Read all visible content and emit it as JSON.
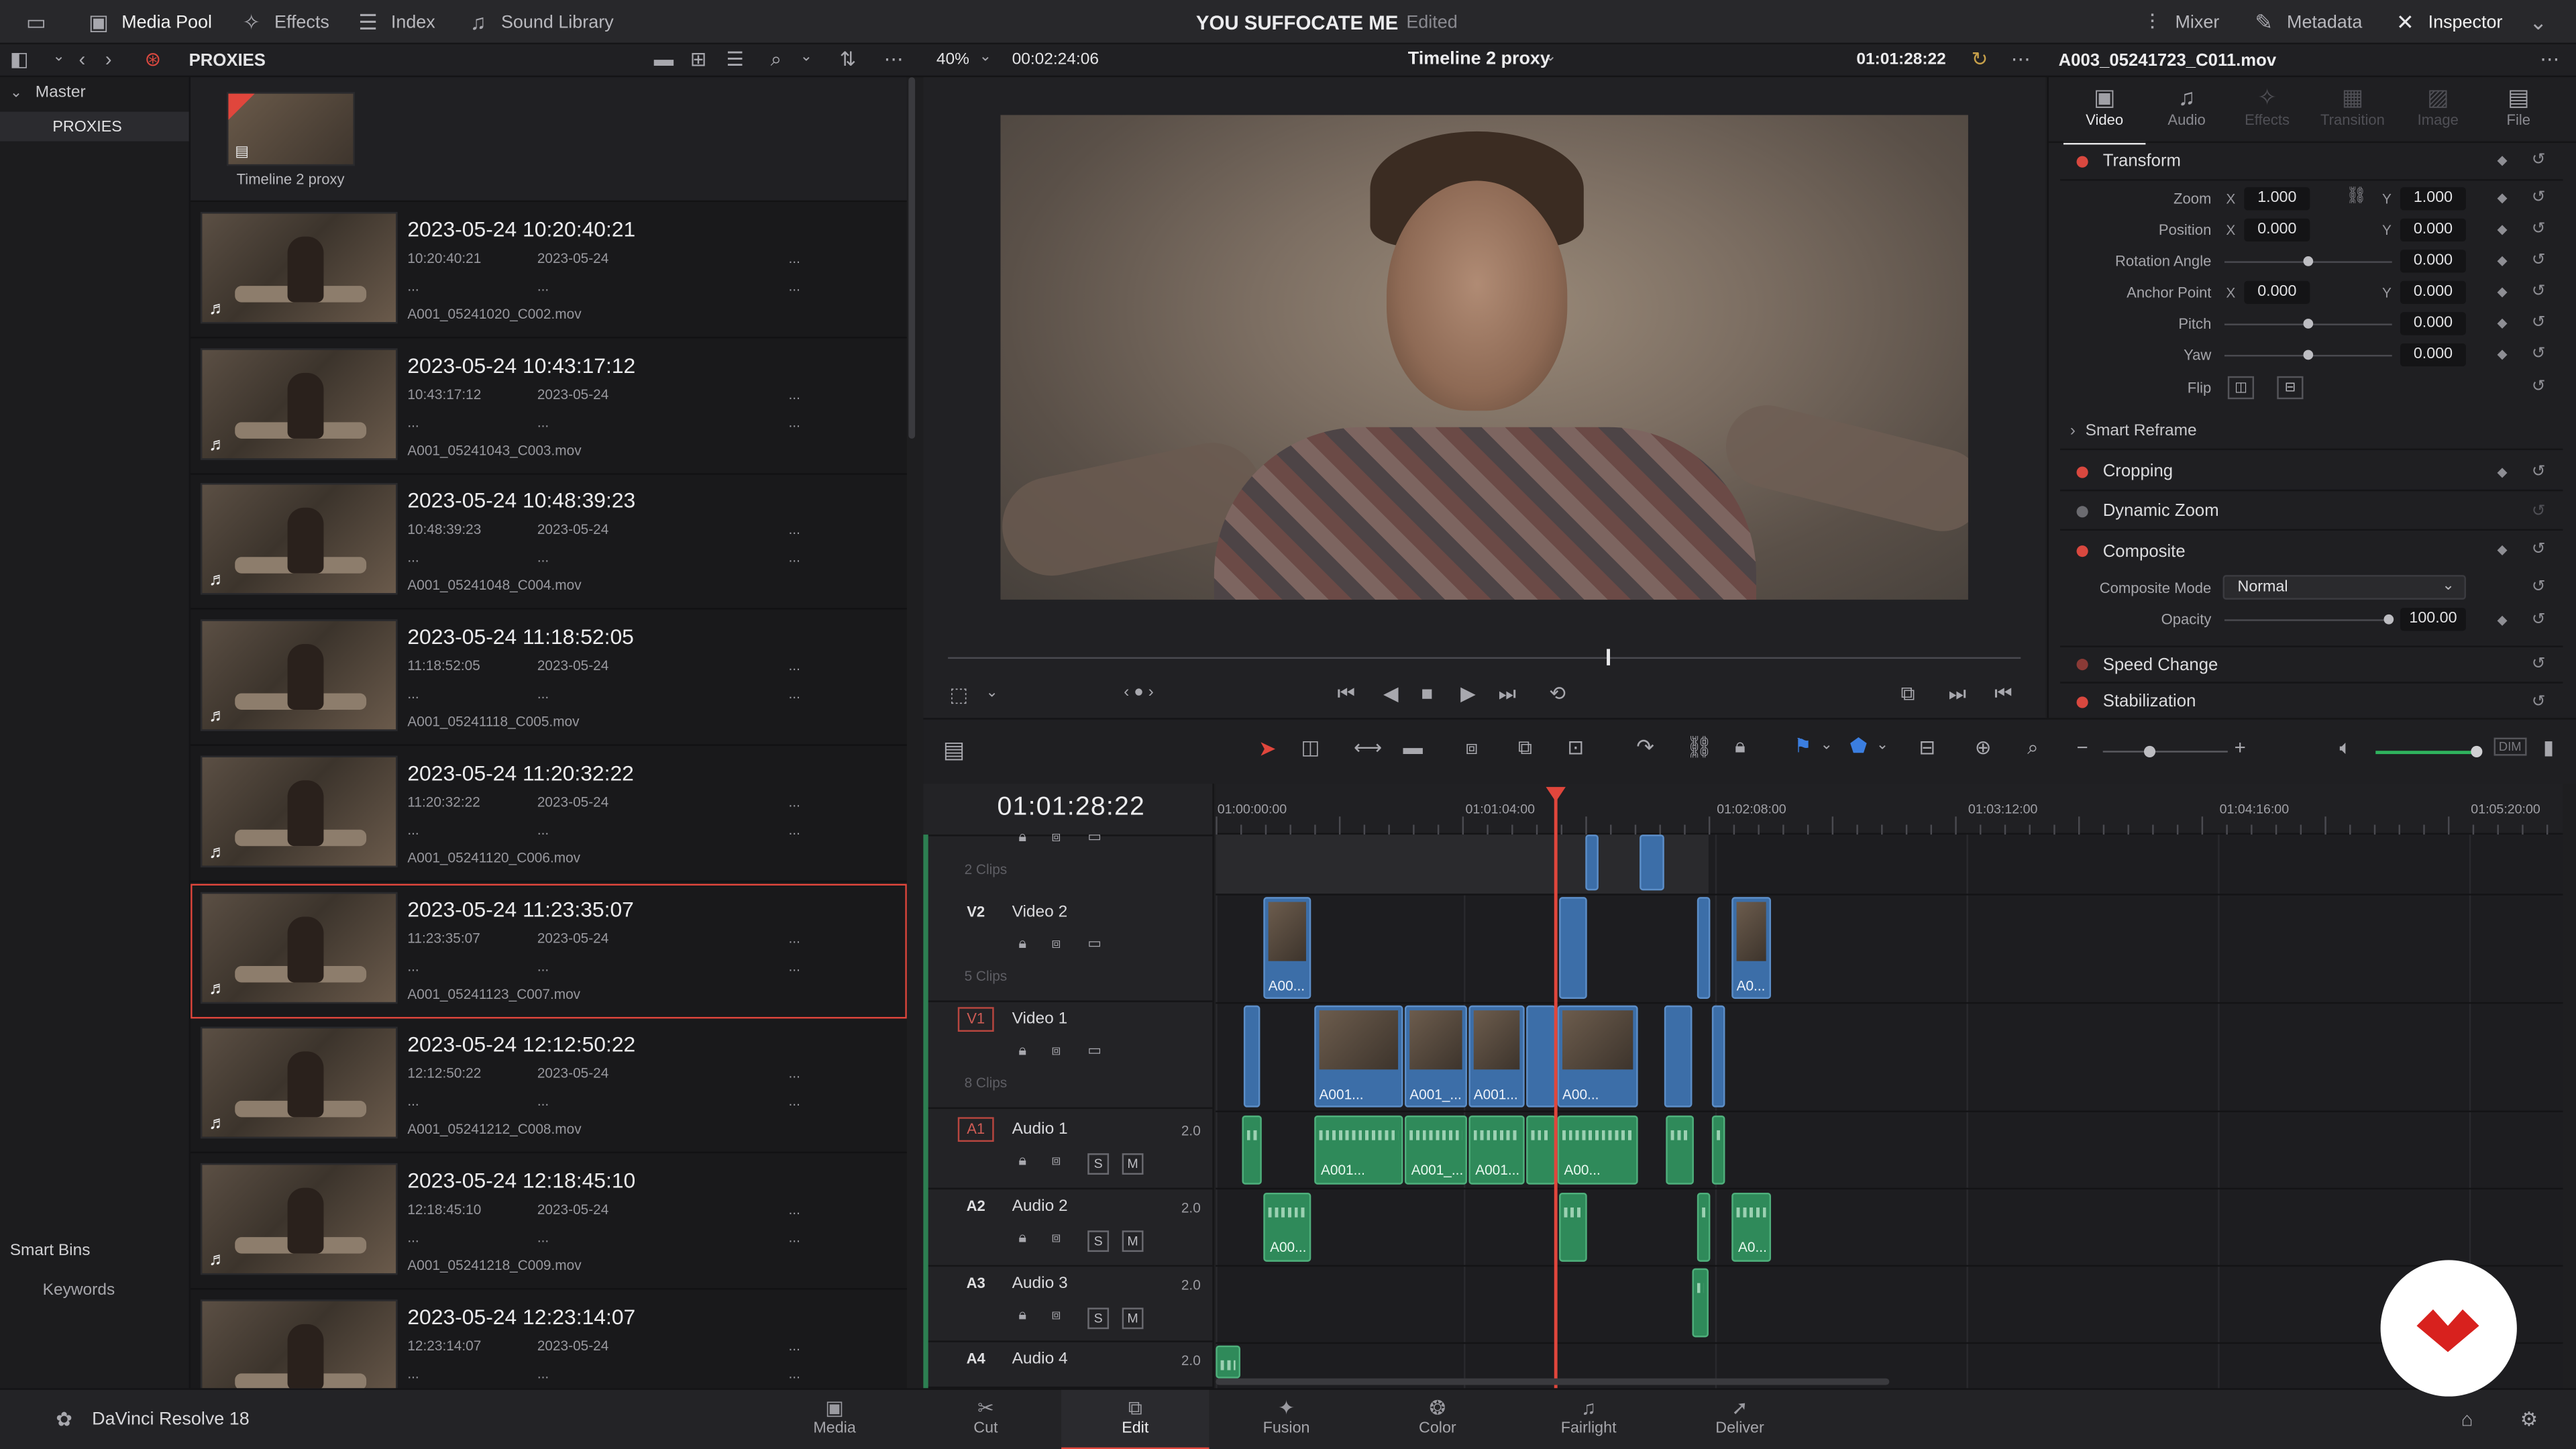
{
  "top": {
    "tabs": [
      {
        "label": "Media Pool",
        "icon": "media-pool-icon"
      },
      {
        "label": "Effects",
        "icon": "effects-icon"
      },
      {
        "label": "Index",
        "icon": "index-icon"
      },
      {
        "label": "Sound Library",
        "icon": "sound-library-icon"
      }
    ],
    "project_title": "YOU SUFFOCATE ME",
    "project_status": "Edited",
    "right_tabs": [
      {
        "label": "Mixer",
        "icon": "mixer-icon"
      },
      {
        "label": "Metadata",
        "icon": "metadata-icon"
      },
      {
        "label": "Inspector",
        "icon": "inspector-icon"
      }
    ]
  },
  "bar2": {
    "bin_name": "PROXIES",
    "zoom": "40%",
    "duration": "00:02:24:06",
    "timeline_name": "Timeline 2 proxy",
    "timecode": "01:01:28:22",
    "clip_name": "A003_05241723_C011.mov"
  },
  "sidebar": {
    "master": "Master",
    "bins": [
      "PROXIES"
    ],
    "smart_bins": "Smart Bins",
    "keywords": "Keywords"
  },
  "pool": {
    "timeline_item": "Timeline 2 proxy",
    "clips": [
      {
        "title": "2023-05-24  10:20:40:21",
        "tc": "10:20:40:21",
        "date": "2023-05-24",
        "c1": "...",
        "c2": "...",
        "c3": "...",
        "file": "A001_05241020_C002.mov"
      },
      {
        "title": "2023-05-24  10:43:17:12",
        "tc": "10:43:17:12",
        "date": "2023-05-24",
        "c1": "...",
        "c2": "...",
        "c3": "...",
        "file": "A001_05241043_C003.mov"
      },
      {
        "title": "2023-05-24  10:48:39:23",
        "tc": "10:48:39:23",
        "date": "2023-05-24",
        "c1": "...",
        "c2": "...",
        "c3": "...",
        "file": "A001_05241048_C004.mov"
      },
      {
        "title": "2023-05-24  11:18:52:05",
        "tc": "11:18:52:05",
        "date": "2023-05-24",
        "c1": "...",
        "c2": "...",
        "c3": "...",
        "file": "A001_05241118_C005.mov"
      },
      {
        "title": "2023-05-24  11:20:32:22",
        "tc": "11:20:32:22",
        "date": "2023-05-24",
        "c1": "...",
        "c2": "...",
        "c3": "...",
        "file": "A001_05241120_C006.mov"
      },
      {
        "title": "2023-05-24  11:23:35:07",
        "tc": "11:23:35:07",
        "date": "2023-05-24",
        "c1": "...",
        "c2": "...",
        "c3": "...",
        "file": "A001_05241123_C007.mov"
      },
      {
        "title": "2023-05-24  12:12:50:22",
        "tc": "12:12:50:22",
        "date": "2023-05-24",
        "c1": "...",
        "c2": "...",
        "c3": "...",
        "file": "A001_05241212_C008.mov"
      },
      {
        "title": "2023-05-24  12:18:45:10",
        "tc": "12:18:45:10",
        "date": "2023-05-24",
        "c1": "...",
        "c2": "...",
        "c3": "...",
        "file": "A001_05241218_C009.mov"
      },
      {
        "title": "2023-05-24  12:23:14:07",
        "tc": "12:23:14:07",
        "date": "2023-05-24",
        "c1": "...",
        "c2": "...",
        "c3": "...",
        "file": ""
      }
    ]
  },
  "inspector": {
    "tabs": [
      "Video",
      "Audio",
      "Effects",
      "Transition",
      "Image",
      "File"
    ],
    "transform": "Transform",
    "zoom_label": "Zoom",
    "zoom_x": "1.000",
    "zoom_y": "1.000",
    "position_label": "Position",
    "pos_x": "0.000",
    "pos_y": "0.000",
    "rotation_label": "Rotation Angle",
    "rotation": "0.000",
    "anchor_label": "Anchor Point",
    "anchor_x": "0.000",
    "anchor_y": "0.000",
    "pitch_label": "Pitch",
    "pitch": "0.000",
    "yaw_label": "Yaw",
    "yaw": "0.000",
    "flip_label": "Flip",
    "x": "X",
    "y": "Y",
    "smart_reframe": "Smart Reframe",
    "cropping": "Cropping",
    "dynamic_zoom": "Dynamic Zoom",
    "composite": "Composite",
    "composite_mode_label": "Composite Mode",
    "composite_mode": "Normal",
    "opacity_label": "Opacity",
    "opacity": "100.00",
    "speed_change": "Speed Change",
    "stabilization": "Stabilization"
  },
  "timeline": {
    "timecode": "01:01:28:22",
    "ruler": [
      "01:00:00:00",
      "01:01:04:00",
      "01:02:08:00",
      "01:03:12:00",
      "01:04:16:00",
      "01:05:20:00"
    ],
    "clips_top": "2 Clips",
    "tracks": [
      {
        "tag": "V2",
        "name": "Video 2",
        "clips": "5 Clips"
      },
      {
        "tag": "V1",
        "name": "Video 1",
        "clips": "8 Clips"
      },
      {
        "tag": "A1",
        "name": "Audio 1",
        "level": "2.0"
      },
      {
        "tag": "A2",
        "name": "Audio 2",
        "level": "2.0"
      },
      {
        "tag": "A3",
        "name": "Audio 3",
        "level": "2.0"
      },
      {
        "tag": "A4",
        "name": "Audio 4",
        "level": "2.0"
      }
    ],
    "clip_labels": {
      "v2a": "A00...",
      "v2b": "A0...",
      "v1a": "A001...",
      "v1b": "A001_...",
      "v1c": "A001...",
      "v1d": "A00...",
      "a1a": "A001...",
      "a1b": "A001_...",
      "a1c": "A001...",
      "a1d": "A00...",
      "a2a": "A00...",
      "a2b": "A0..."
    },
    "solo": "S",
    "mute": "M",
    "dim": "DIM"
  },
  "bottom": {
    "app": "DaVinci Resolve 18",
    "pages": [
      {
        "label": "Media",
        "icon": "media-page-icon"
      },
      {
        "label": "Cut",
        "icon": "cut-page-icon"
      },
      {
        "label": "Edit",
        "icon": "edit-page-icon"
      },
      {
        "label": "Fusion",
        "icon": "fusion-page-icon"
      },
      {
        "label": "Color",
        "icon": "color-page-icon"
      },
      {
        "label": "Fairlight",
        "icon": "fairlight-page-icon"
      },
      {
        "label": "Deliver",
        "icon": "deliver-page-icon"
      }
    ],
    "active_page": "Edit"
  },
  "colors": {
    "accent_red": "#e0463c",
    "video_clip": "#3c6ea8",
    "audio_clip": "#2f8a5a",
    "playhead": "#e0463c"
  }
}
